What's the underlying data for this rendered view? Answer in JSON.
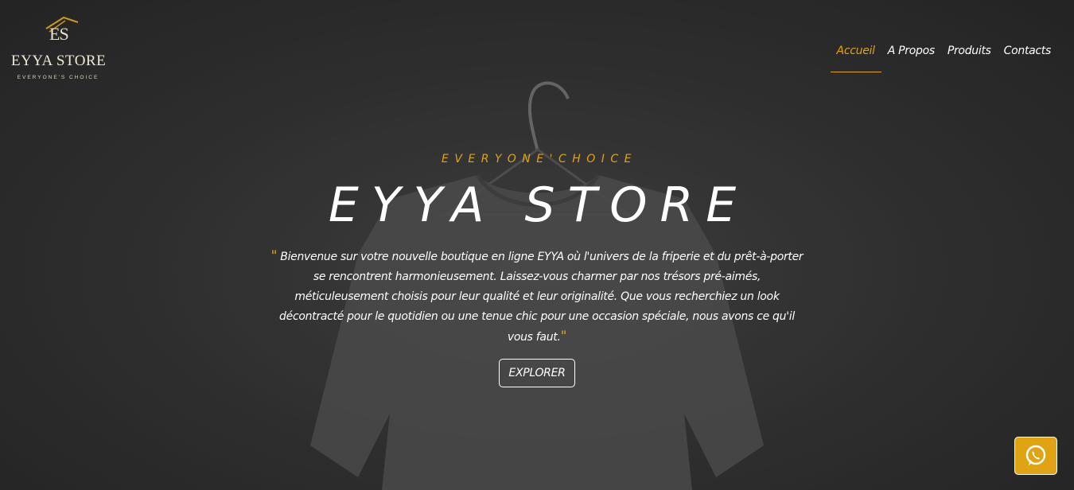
{
  "logo": {
    "monogram": "ES",
    "name": "EYYA STORE",
    "tagline": "EVERYONE'S CHOICE"
  },
  "nav": {
    "items": [
      {
        "label": "Accueil",
        "active": true
      },
      {
        "label": "A Propos",
        "active": false
      },
      {
        "label": "Produits",
        "active": false
      },
      {
        "label": "Contacts",
        "active": false
      }
    ]
  },
  "hero": {
    "tagline": "EVERYONE'CHOICE",
    "title": "EYYA STORE",
    "quote_open": "\"",
    "quote_close": "\"",
    "description": " Bienvenue sur votre nouvelle boutique en ligne EYYA où l'univers de la friperie et du prêt-à-porter se rencontrent harmonieusement. Laissez-vous charmer par nos trésors pré-aimés, méticuleusement choisis pour leur qualité et leur originalité. Que vous recherchiez un look décontracté pour le quotidien ou une tenue chic pour une occasion spéciale, nous avons ce qu'il vous faut.",
    "button_label": "EXPLORER"
  },
  "whatsapp": {
    "icon": "whatsapp-icon"
  },
  "colors": {
    "accent": "#e0a313",
    "background": "#3a3a3a",
    "text": "#ffffff"
  }
}
